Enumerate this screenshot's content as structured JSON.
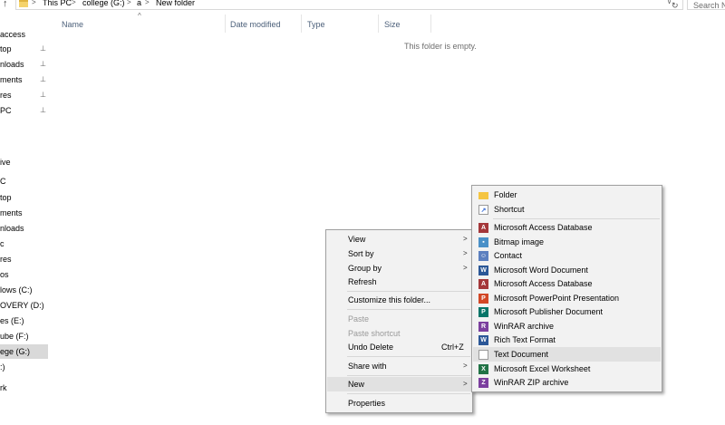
{
  "address": {
    "crumbs": [
      "This PC",
      "college (G:)",
      "a",
      "New folder"
    ],
    "separator": ">",
    "up_glyph": "↑",
    "dropdown_glyph": "∨",
    "refresh_glyph": "↻",
    "search_placeholder": "Search N"
  },
  "nav": {
    "items": [
      {
        "label": "access",
        "pinned": false
      },
      {
        "label": "top",
        "pinned": true
      },
      {
        "label": "nloads",
        "pinned": true
      },
      {
        "label": "ments",
        "pinned": true
      },
      {
        "label": "res",
        "pinned": true
      },
      {
        "label": "PC",
        "pinned": true
      },
      {
        "label": "ive",
        "pinned": false
      },
      {
        "label": "C",
        "pinned": false
      },
      {
        "label": "top",
        "pinned": false
      },
      {
        "label": "ments",
        "pinned": false
      },
      {
        "label": "nloads",
        "pinned": false
      },
      {
        "label": "c",
        "pinned": false
      },
      {
        "label": "res",
        "pinned": false
      },
      {
        "label": "os",
        "pinned": false
      },
      {
        "label": "lows (C:)",
        "pinned": false
      },
      {
        "label": "OVERY (D:)",
        "pinned": false
      },
      {
        "label": "es (E:)",
        "pinned": false
      },
      {
        "label": "ube (F:)",
        "pinned": false
      },
      {
        "label": "ege (G:)",
        "pinned": false,
        "selected": true
      },
      {
        "label": ":)",
        "pinned": false
      },
      {
        "label": "rk",
        "pinned": false
      }
    ],
    "pin_glyph": "📌"
  },
  "columns": [
    "Name",
    "Date modified",
    "Type",
    "Size"
  ],
  "sort_glyph": "^",
  "empty_message": "This folder is empty.",
  "context_menu": {
    "items": [
      {
        "label": "View",
        "submenu": true
      },
      {
        "label": "Sort by",
        "submenu": true
      },
      {
        "label": "Group by",
        "submenu": true
      },
      {
        "label": "Refresh"
      },
      {
        "label": "Customize this folder..."
      },
      {
        "label": "Paste",
        "disabled": true
      },
      {
        "label": "Paste shortcut",
        "disabled": true
      },
      {
        "label": "Undo Delete",
        "shortcut": "Ctrl+Z"
      },
      {
        "label": "Share with",
        "submenu": true
      },
      {
        "label": "New",
        "submenu": true,
        "hover": true
      },
      {
        "label": "Properties"
      }
    ],
    "arrow_glyph": ">"
  },
  "new_submenu": {
    "items": [
      {
        "label": "Folder",
        "icon": "folder-icon",
        "color": "#f5c542"
      },
      {
        "label": "Shortcut",
        "icon": "shortcut-icon",
        "color": "#3a6fd8"
      },
      {
        "label": "Microsoft Access Database",
        "icon": "access-icon",
        "color": "#a4373a"
      },
      {
        "label": "Bitmap image",
        "icon": "bitmap-icon",
        "color": "#4a90c8"
      },
      {
        "label": "Contact",
        "icon": "contact-icon",
        "color": "#5b7fbf"
      },
      {
        "label": "Microsoft Word Document",
        "icon": "word-icon",
        "color": "#2b5797"
      },
      {
        "label": "Microsoft Access Database",
        "icon": "access-icon",
        "color": "#a4373a"
      },
      {
        "label": "Microsoft PowerPoint Presentation",
        "icon": "powerpoint-icon",
        "color": "#d24726"
      },
      {
        "label": "Microsoft Publisher Document",
        "icon": "publisher-icon",
        "color": "#077568"
      },
      {
        "label": "WinRAR archive",
        "icon": "winrar-icon",
        "color": "#7b3f9e"
      },
      {
        "label": "Rich Text Format",
        "icon": "rtf-icon",
        "color": "#2b5797"
      },
      {
        "label": "Text Document",
        "icon": "text-document-icon",
        "color": "#9a9a9a",
        "hover": true
      },
      {
        "label": "Microsoft Excel Worksheet",
        "icon": "excel-icon",
        "color": "#217346"
      },
      {
        "label": "WinRAR ZIP archive",
        "icon": "winrar-zip-icon",
        "color": "#7b3f9e"
      }
    ]
  }
}
